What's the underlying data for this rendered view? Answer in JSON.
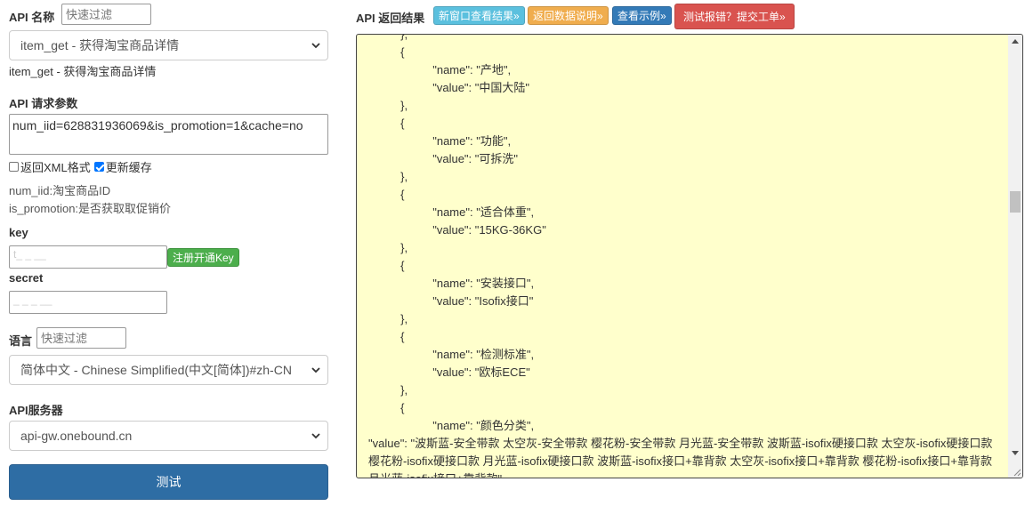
{
  "left": {
    "api_name_label": "API 名称",
    "api_filter_placeholder": "快速过滤",
    "api_select_value": "item_get - 获得淘宝商品详情",
    "api_selected_text": "item_get - 获得淘宝商品详情",
    "params_label": "API 请求参数",
    "params_value": "num_iid=628831936069&is_promotion=1&cache=no",
    "xml_checkbox_label": "返回XML格式",
    "xml_checked": false,
    "cache_checkbox_label": "更新缓存",
    "cache_checked": true,
    "param_help": [
      "num_iid:淘宝商品ID",
      "is_promotion:是否获取取促销价"
    ],
    "key_label": "key",
    "key_value": "t_ _ __",
    "register_key_button": "注册开通Key",
    "secret_label": "secret",
    "secret_value": "_ _ _ __",
    "lang_label": "语言",
    "lang_filter_placeholder": "快速过滤",
    "lang_select_value": "简体中文 - Chinese Simplified(中文[简体])#zh-CN",
    "server_label": "API服务器",
    "server_select_value": "api-gw.onebound.cn",
    "test_button": "测试"
  },
  "right": {
    "result_label": "API 返回结果",
    "buttons": {
      "new_window": "新窗口查看结果»",
      "return_doc": "返回数据说明»",
      "example": "查看示例»",
      "report": "测试报错？提交工单»"
    },
    "button_colors": {
      "new_window": "#5bc0de",
      "return_doc": "#f0ad4e",
      "example": "#337ab7",
      "report": "#d9534f"
    },
    "code_lines": [
      "          },",
      "          {",
      "                    \"name\": \"产地\",",
      "                    \"value\": \"中国大陆\"",
      "          },",
      "          {",
      "                    \"name\": \"功能\",",
      "                    \"value\": \"可拆洗\"",
      "          },",
      "          {",
      "                    \"name\": \"适合体重\",",
      "                    \"value\": \"15KG-36KG\"",
      "          },",
      "          {",
      "                    \"name\": \"安装接口\",",
      "                    \"value\": \"Isofix接口\"",
      "          },",
      "          {",
      "                    \"name\": \"检测标准\",",
      "                    \"value\": \"欧标ECE\"",
      "          },",
      "          {",
      "                    \"name\": \"颜色分类\","
    ],
    "code_last_line": "                    \"value\": \"波斯蓝-安全带款 太空灰-安全带款 樱花粉-安全带款 月光蓝-安全带款 波斯蓝-isofix硬接口款 太空灰-isofix硬接口款 樱花粉-isofix硬接口款 月光蓝-isofix硬接口款 波斯蓝-isofix接口+靠背款 太空灰-isofix接口+靠背款 樱花粉-isofix接口+靠背款 月光蓝-isofix接口+靠背款\""
  }
}
